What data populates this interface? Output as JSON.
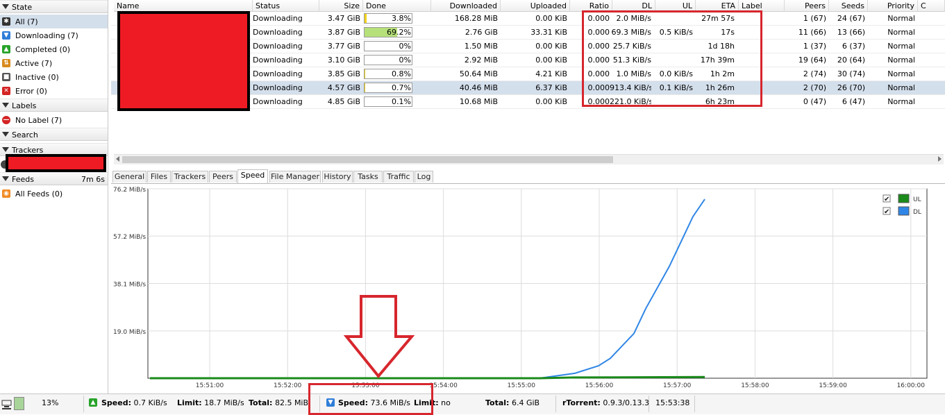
{
  "sidebar": {
    "state_header": "State",
    "state_items": [
      {
        "label": "All (7)",
        "icon": "all-icon",
        "color": "#333333"
      },
      {
        "label": "Downloading (7)",
        "icon": "downloading-icon",
        "color": "#2f7ed8"
      },
      {
        "label": "Completed (0)",
        "icon": "completed-icon",
        "color": "#27a32a"
      },
      {
        "label": "Active (7)",
        "icon": "active-icon",
        "color": "#d88a1e"
      },
      {
        "label": "Inactive (0)",
        "icon": "inactive-icon",
        "color": "#555555"
      },
      {
        "label": "Error (0)",
        "icon": "error-icon",
        "color": "#d42323"
      }
    ],
    "labels_header": "Labels",
    "label_items": [
      {
        "label": "No Label (7)",
        "icon": "no-label-icon",
        "color": "#d42323"
      }
    ],
    "search_header": "Search",
    "trackers_header": "Trackers",
    "feeds_header": "Feeds",
    "feeds_time": "7m 6s",
    "feed_items": [
      {
        "label": "All Feeds (0)",
        "icon": "rss-icon",
        "color": "#f08a24"
      }
    ]
  },
  "table": {
    "columns": [
      "Name",
      "Status",
      "Size",
      "Done",
      "Downloaded",
      "Uploaded",
      "Ratio",
      "DL",
      "UL",
      "ETA",
      "Label",
      "Peers",
      "Seeds",
      "Priority",
      "C"
    ],
    "rows": [
      {
        "status": "Downloading",
        "size": "3.47 GiB",
        "done": "3.8%",
        "done_frac": 0.038,
        "downloaded": "168.28 MiB",
        "uploaded": "0.00 KiB",
        "ratio": "0.000",
        "dl": "2.0 MiB/s",
        "ul": "",
        "eta": "27m 57s",
        "label": "",
        "peers": "1 (67)",
        "seeds": "24 (67)",
        "priority": "Normal"
      },
      {
        "status": "Downloading",
        "size": "3.87 GiB",
        "done": "69.2%",
        "done_frac": 0.692,
        "downloaded": "2.76 GiB",
        "uploaded": "33.31 KiB",
        "ratio": "0.000",
        "dl": "69.3 MiB/s",
        "ul": "0.5 KiB/s",
        "eta": "17s",
        "label": "",
        "peers": "11 (66)",
        "seeds": "13 (66)",
        "priority": "Normal"
      },
      {
        "status": "Downloading",
        "size": "3.77 GiB",
        "done": "0%",
        "done_frac": 0,
        "downloaded": "1.50 MiB",
        "uploaded": "0.00 KiB",
        "ratio": "0.000",
        "dl": "25.7 KiB/s",
        "ul": "",
        "eta": "1d 18h",
        "label": "",
        "peers": "1 (37)",
        "seeds": "6 (37)",
        "priority": "Normal"
      },
      {
        "status": "Downloading",
        "size": "3.10 GiB",
        "done": "0%",
        "done_frac": 0,
        "downloaded": "2.92 MiB",
        "uploaded": "0.00 KiB",
        "ratio": "0.000",
        "dl": "51.3 KiB/s",
        "ul": "",
        "eta": "17h 39m",
        "label": "",
        "peers": "19 (64)",
        "seeds": "20 (64)",
        "priority": "Normal"
      },
      {
        "status": "Downloading",
        "size": "3.85 GiB",
        "done": "0.8%",
        "done_frac": 0.008,
        "downloaded": "50.64 MiB",
        "uploaded": "4.21 KiB",
        "ratio": "0.000",
        "dl": "1.0 MiB/s",
        "ul": "0.0 KiB/s",
        "eta": "1h 2m",
        "label": "",
        "peers": "2 (74)",
        "seeds": "30 (74)",
        "priority": "Normal"
      },
      {
        "status": "Downloading",
        "size": "4.57 GiB",
        "done": "0.7%",
        "done_frac": 0.007,
        "downloaded": "40.46 MiB",
        "uploaded": "6.37 KiB",
        "ratio": "0.000",
        "dl": "913.4 KiB/s",
        "ul": "0.1 KiB/s",
        "eta": "1h 26m",
        "label": "",
        "peers": "2 (70)",
        "seeds": "26 (70)",
        "priority": "Normal",
        "selected": true
      },
      {
        "status": "Downloading",
        "size": "4.85 GiB",
        "done": "0.1%",
        "done_frac": 0.001,
        "downloaded": "10.68 MiB",
        "uploaded": "0.00 KiB",
        "ratio": "0.000",
        "dl": "221.0 KiB/s",
        "ul": "",
        "eta": "6h 23m",
        "label": "",
        "peers": "0 (47)",
        "seeds": "6 (47)",
        "priority": "Normal"
      }
    ]
  },
  "tabs": [
    "General",
    "Files",
    "Trackers",
    "Peers",
    "Speed",
    "File Manager",
    "History",
    "Tasks",
    "Traffic",
    "Log"
  ],
  "active_tab": "Speed",
  "chart_data": {
    "type": "line",
    "ylim": [
      0,
      76.2
    ],
    "y_ticks": [
      "76.2 MiB/s",
      "57.2 MiB/s",
      "38.1 MiB/s",
      "19.0 MiB/s"
    ],
    "x_ticks": [
      "15:51:00",
      "15:52:00",
      "15:53:00",
      "15:54:00",
      "15:55:00",
      "15:56:00",
      "15:57:00",
      "15:58:00",
      "15:59:00",
      "16:00:00"
    ],
    "legend": [
      {
        "name": "UL",
        "color": "#1a8a1a",
        "checked": true
      },
      {
        "name": "DL",
        "color": "#2f86e6",
        "checked": true
      }
    ],
    "series": [
      {
        "name": "DL",
        "color": "#2f86e6",
        "x": [
          0,
          330,
          360,
          380,
          390,
          410,
          420,
          440,
          450,
          460,
          470
        ],
        "values": [
          0,
          0,
          2,
          5,
          8,
          18,
          28,
          45,
          55,
          65,
          72
        ]
      },
      {
        "name": "UL",
        "color": "#1a8a1a",
        "x": [
          0,
          330,
          360,
          470
        ],
        "values": [
          0,
          0,
          0.3,
          0.5
        ]
      }
    ]
  },
  "status": {
    "network_pct": "13%",
    "ul_speed_label": "Speed:",
    "ul_speed": "0.7 KiB/s",
    "ul_limit_label": "Limit:",
    "ul_limit": "18.7 MiB/s",
    "ul_total_label": "Total:",
    "ul_total": "82.5 MiB",
    "dl_speed_label": "Speed:",
    "dl_speed": "73.6 MiB/s",
    "dl_limit_label": "Limit:",
    "dl_limit": "no",
    "dl_total_label": "Total:",
    "dl_total": "6.4 GiB",
    "client_label": "rTorrent:",
    "client_version": "0.9.3/0.13.3",
    "clock": "15:53:38"
  }
}
